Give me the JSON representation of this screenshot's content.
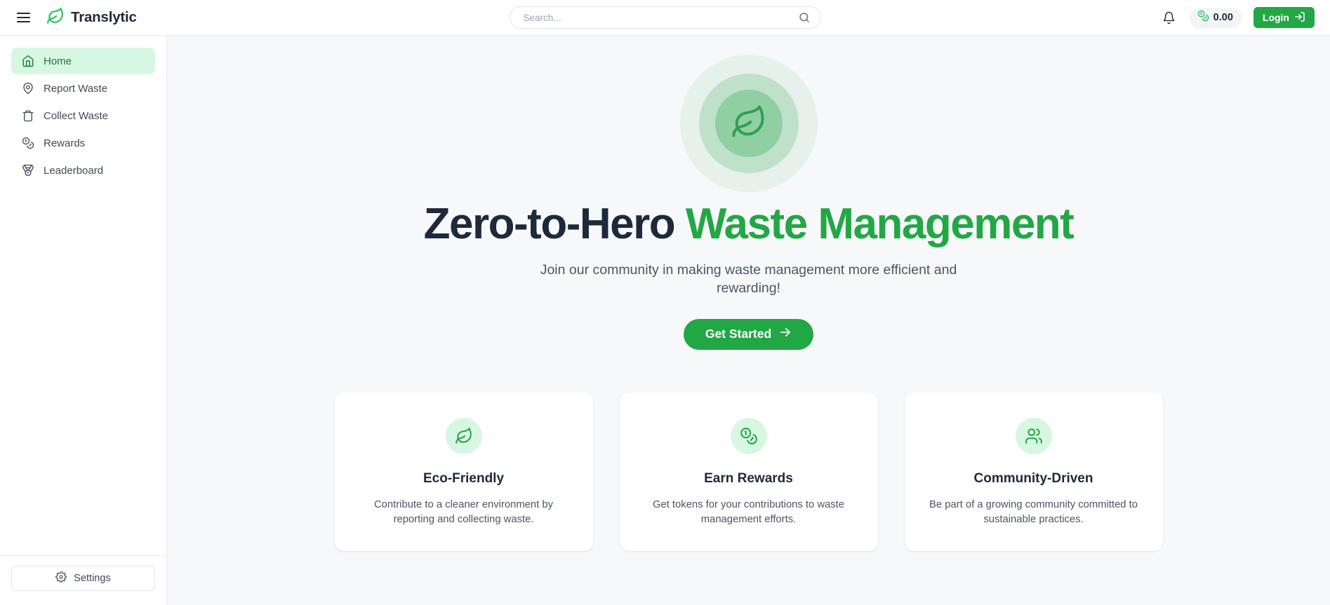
{
  "header": {
    "menu_icon": "hamburger-menu-icon",
    "brand": {
      "name": "Translytic",
      "logo_icon": "leaf-icon"
    },
    "search": {
      "placeholder": "Search...",
      "value": "",
      "icon": "search-icon"
    },
    "notifications_icon": "bell-icon",
    "balance": {
      "icon": "coins-icon",
      "value": "0.00"
    },
    "login": {
      "label": "Login",
      "icon": "sign-in-icon"
    }
  },
  "sidebar": {
    "items": [
      {
        "label": "Home",
        "icon": "home-icon",
        "active": true
      },
      {
        "label": "Report Waste",
        "icon": "map-pin-icon",
        "active": false
      },
      {
        "label": "Collect Waste",
        "icon": "trash-icon",
        "active": false
      },
      {
        "label": "Rewards",
        "icon": "coins-icon",
        "active": false
      },
      {
        "label": "Leaderboard",
        "icon": "medal-icon",
        "active": false
      }
    ],
    "settings": {
      "label": "Settings",
      "icon": "gear-icon"
    }
  },
  "hero": {
    "badge_icon": "leaf-icon",
    "title_primary": "Zero-to-Hero ",
    "title_accent": "Waste Management",
    "subtitle": "Join our community in making waste management more efficient and rewarding!",
    "cta": {
      "label": "Get Started",
      "icon": "arrow-right-icon"
    }
  },
  "features": [
    {
      "icon": "leaf-icon",
      "title": "Eco-Friendly",
      "description": "Contribute to a cleaner environment by reporting and collecting waste."
    },
    {
      "icon": "coins-icon",
      "title": "Earn Rewards",
      "description": "Get tokens for your contributions to waste management efforts."
    },
    {
      "icon": "users-icon",
      "title": "Community-Driven",
      "description": "Be part of a growing community committed to sustainable practices."
    }
  ],
  "colors": {
    "brand_green": "#22a745",
    "dark_navy": "#1e2a3b",
    "active_nav_bg": "#d8f7e2",
    "active_nav_text": "#1b7a3c",
    "main_bg": "#f7f8fa",
    "muted_text": "#4a5568"
  }
}
